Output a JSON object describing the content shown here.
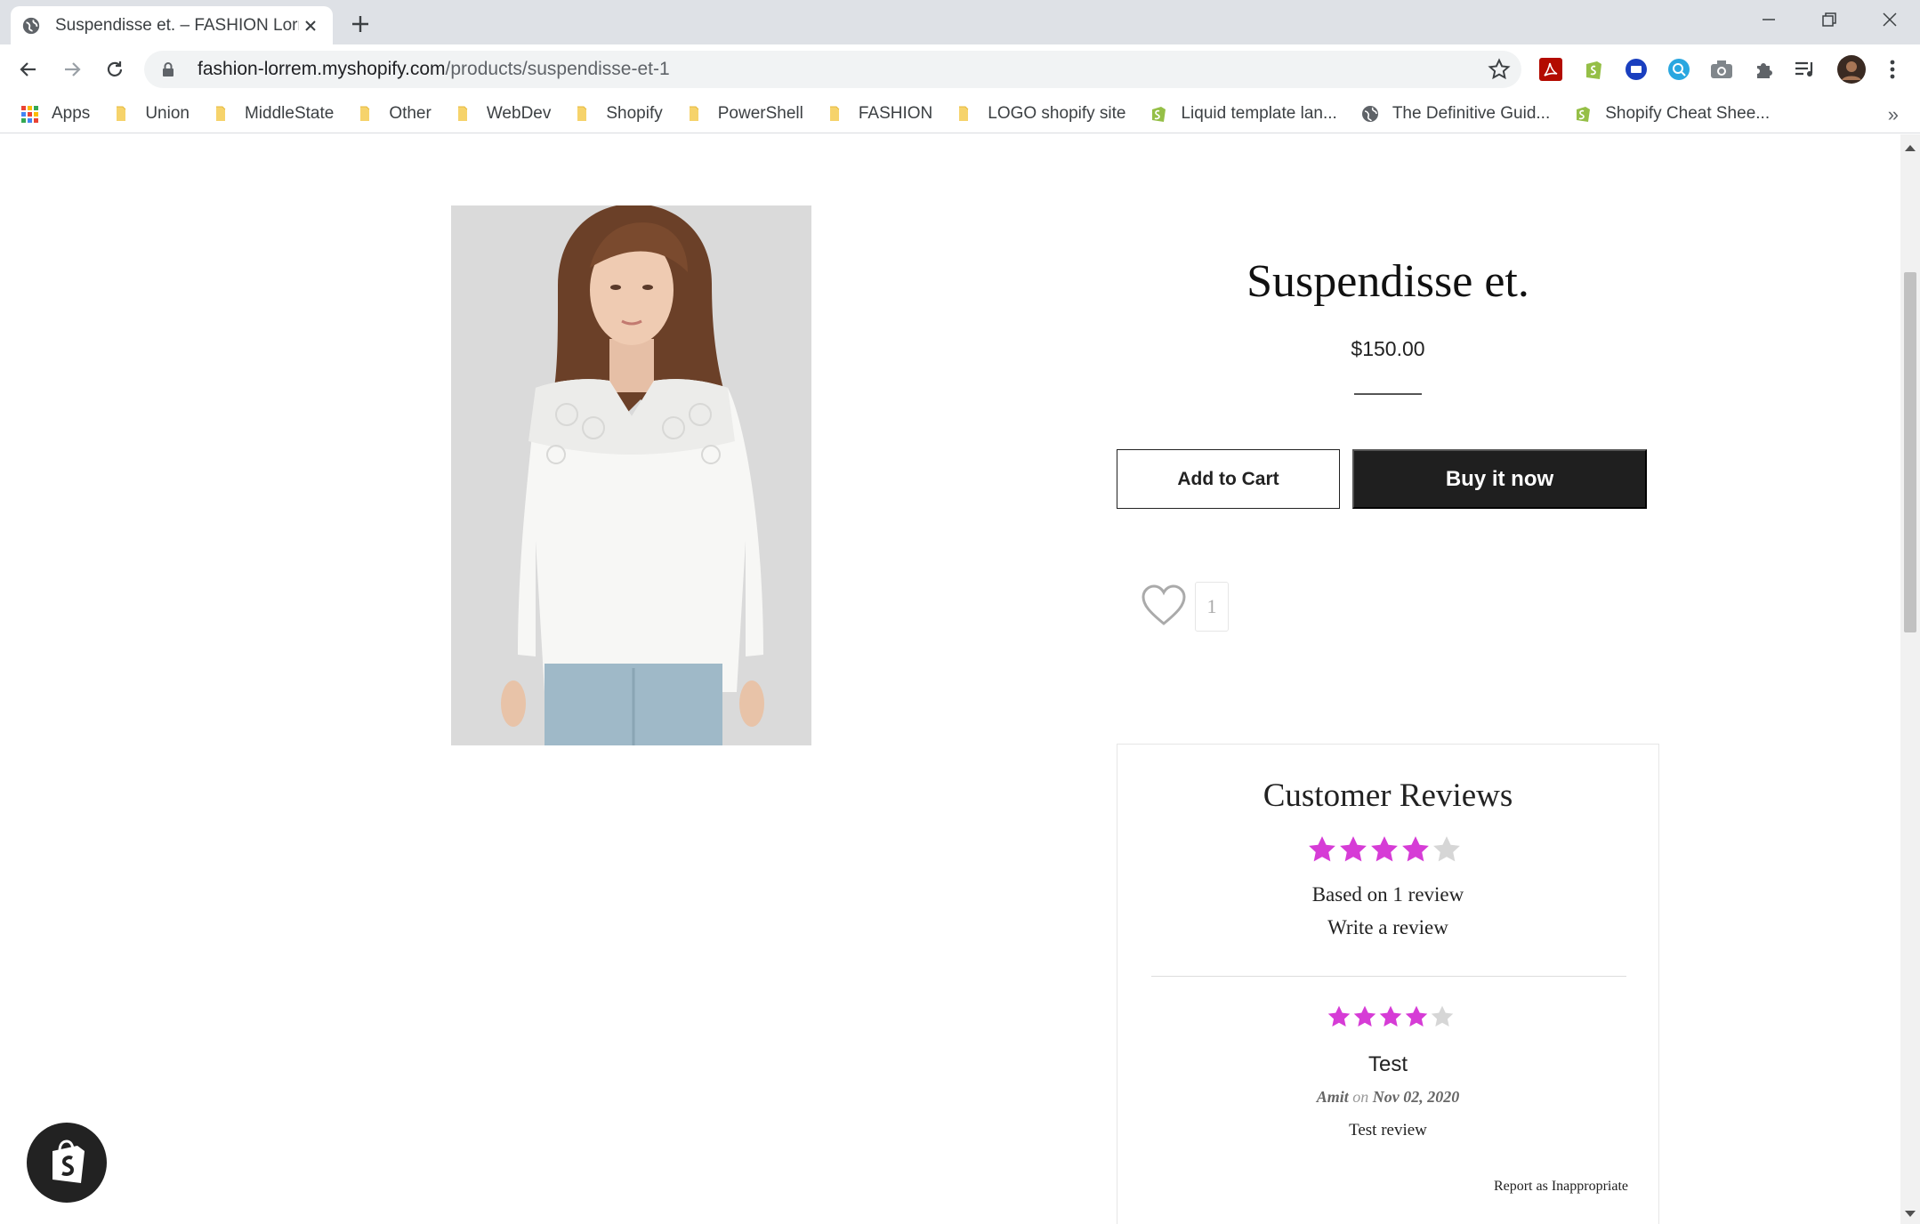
{
  "browser": {
    "tab_title": "Suspendisse et. – FASHION Lorrem",
    "new_tab_symbol": "+",
    "url_host": "fashion-lorrem.myshopify.com",
    "url_path": "/products/suspendisse-et-1",
    "bookmarks": [
      {
        "label": "Apps",
        "icon": "apps-grid-icon"
      },
      {
        "label": "Union",
        "icon": "folder-icon"
      },
      {
        "label": "MiddleState",
        "icon": "folder-icon"
      },
      {
        "label": "Other",
        "icon": "folder-icon"
      },
      {
        "label": "WebDev",
        "icon": "folder-icon"
      },
      {
        "label": "Shopify",
        "icon": "folder-icon"
      },
      {
        "label": "PowerShell",
        "icon": "folder-icon"
      },
      {
        "label": "FASHION",
        "icon": "folder-icon"
      },
      {
        "label": "LOGO shopify site",
        "icon": "folder-icon"
      },
      {
        "label": "Liquid template lan...",
        "icon": "shopify-icon"
      },
      {
        "label": "The Definitive Guid...",
        "icon": "globe-icon"
      },
      {
        "label": "Shopify Cheat Shee...",
        "icon": "shopify-icon"
      }
    ],
    "bookmarks_more": "»"
  },
  "product": {
    "title": "Suspendisse et.",
    "price": "$150.00",
    "add_to_cart_label": "Add to Cart",
    "buy_now_label": "Buy it now",
    "wishlist_count": "1",
    "image_description_icon": "product-photo-white-blouse"
  },
  "reviews": {
    "heading": "Customer Reviews",
    "average_rating": 4,
    "max_rating": 5,
    "based_on": "Based on 1 review",
    "write_review": "Write a review",
    "items": [
      {
        "rating": 4,
        "title": "Test",
        "author": "Amit",
        "on": "on",
        "date": "Nov 02, 2020",
        "body": "Test review",
        "report_label": "Report as Inappropriate"
      }
    ]
  },
  "colors": {
    "star_filled": "#d63cd6",
    "star_empty": "#d6d6d6",
    "buy_button": "#1f1f1f"
  }
}
